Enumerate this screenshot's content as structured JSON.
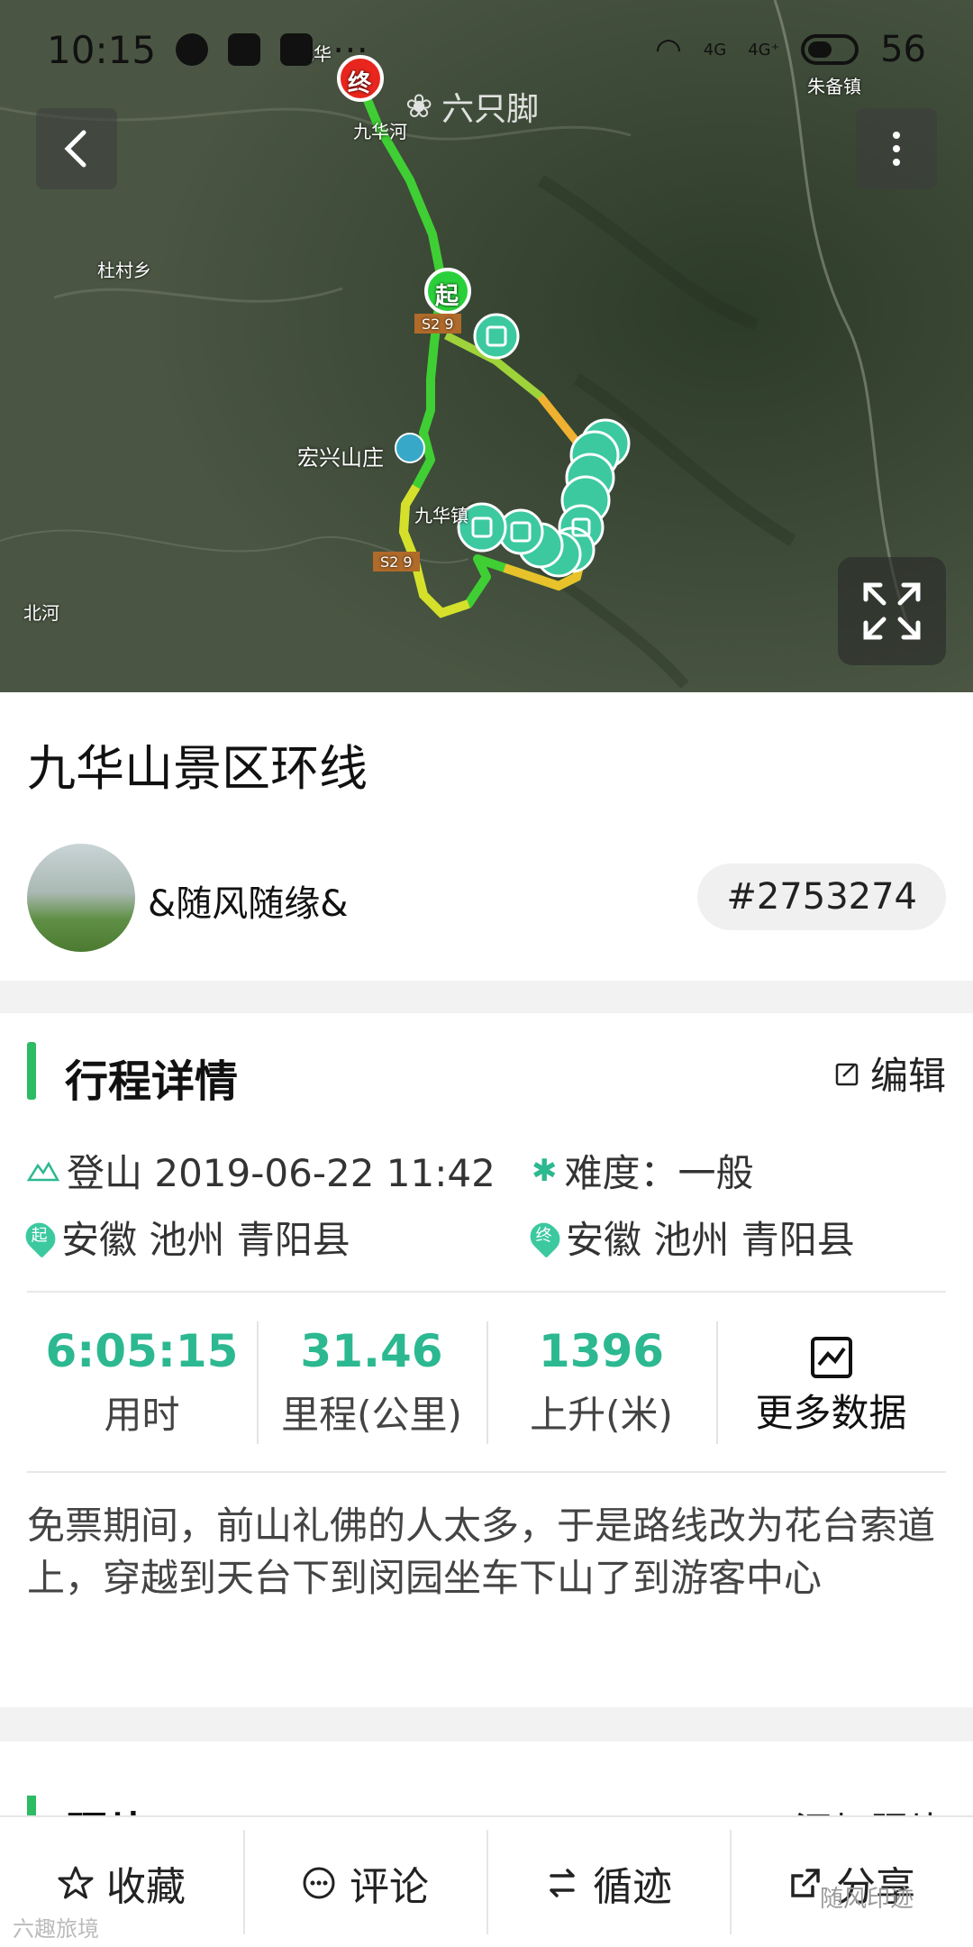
{
  "statusbar": {
    "time": "10:15",
    "net1": "4G",
    "net2": "4G⁺",
    "battery": "56"
  },
  "map": {
    "brand": "六只脚",
    "labels": {
      "dutun": "杜村乡",
      "hongxing": "宏兴山庄",
      "jiuhuazhen": "九华镇",
      "beihe": "北河",
      "zhubei": "朱备镇",
      "jiuhuahe": "九华河",
      "jiuhua": "九华",
      "road1": "S2 9",
      "road2": "S2 9"
    },
    "start_marker": "起",
    "end_marker": "终"
  },
  "route": {
    "title": "九华山景区环线",
    "username": "&随风随缘&",
    "id": "#2753274"
  },
  "details": {
    "section_title": "行程详情",
    "edit_label": "编辑",
    "activity": "登山 2019-06-22 11:42",
    "difficulty": "难度：一般",
    "start_place": "安徽 池州 青阳县",
    "end_place": "安徽 池州 青阳县",
    "start_badge": "起",
    "end_badge": "终",
    "stats": [
      {
        "value": "6:05:15",
        "label": "用时"
      },
      {
        "value": "31.46",
        "label": "里程(公里)"
      },
      {
        "value": "1396",
        "label": "上升(米)"
      }
    ],
    "more_label": "更多数据",
    "description": "免票期间，前山礼佛的人太多，于是路线改为花台索道上，穿越到天台下到闵园坐车下山了到游客中心"
  },
  "peek": {
    "title": "照片",
    "right": "添加照片"
  },
  "bottom_bar": {
    "favorite": "收藏",
    "comment": "评论",
    "follow_track": "循迹",
    "share": "分享"
  },
  "watermarks": {
    "left": "六趣旅境",
    "right": "随风印迹"
  },
  "colors": {
    "accent": "#2dbb64",
    "stat": "#2cb890",
    "marker": "#3cc9a0"
  }
}
